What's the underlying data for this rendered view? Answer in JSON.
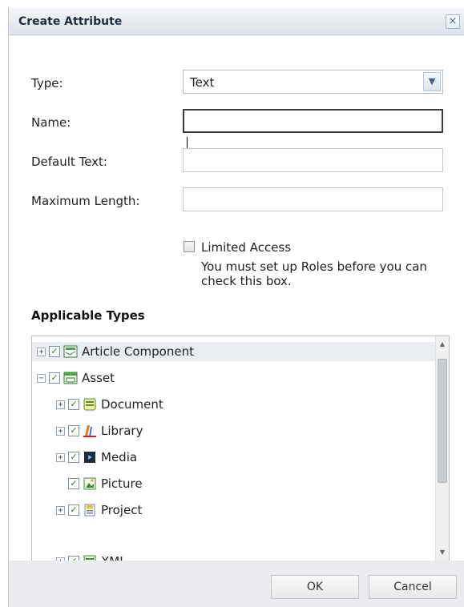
{
  "dialog": {
    "title": "Create Attribute",
    "close_glyph": "×"
  },
  "form": {
    "type_label": "Type:",
    "type_value": "Text",
    "name_label": "Name:",
    "name_value": "",
    "default_text_label": "Default Text:",
    "default_text_value": "",
    "max_length_label": "Maximum Length:",
    "max_length_value": "",
    "limited_access_label": "Limited Access",
    "limited_access_checked": false,
    "limited_access_note": "You must set up Roles before you can check this box."
  },
  "applicable_types": {
    "title": "Applicable Types",
    "items": [
      {
        "label": "Article Component",
        "icon": "article-component-icon",
        "checked": true,
        "expander": "+"
      },
      {
        "label": "Asset",
        "icon": "asset-icon",
        "checked": true,
        "expander": "−"
      },
      {
        "label": "Document",
        "icon": "document-icon",
        "checked": true,
        "expander": "+"
      },
      {
        "label": "Library",
        "icon": "library-icon",
        "checked": true,
        "expander": "+"
      },
      {
        "label": "Media",
        "icon": "media-icon",
        "checked": true,
        "expander": "+"
      },
      {
        "label": "Picture",
        "icon": "picture-icon",
        "checked": true,
        "expander": ""
      },
      {
        "label": "Project",
        "icon": "project-icon",
        "checked": true,
        "expander": "+"
      },
      {
        "label": "XML",
        "icon": "xml-icon",
        "checked": true,
        "expander": "+"
      }
    ]
  },
  "buttons": {
    "ok": "OK",
    "cancel": "Cancel"
  },
  "glyphs": {
    "check": "✓",
    "dropdown": "▼",
    "scroll_up": "▲",
    "scroll_down": "▼"
  }
}
